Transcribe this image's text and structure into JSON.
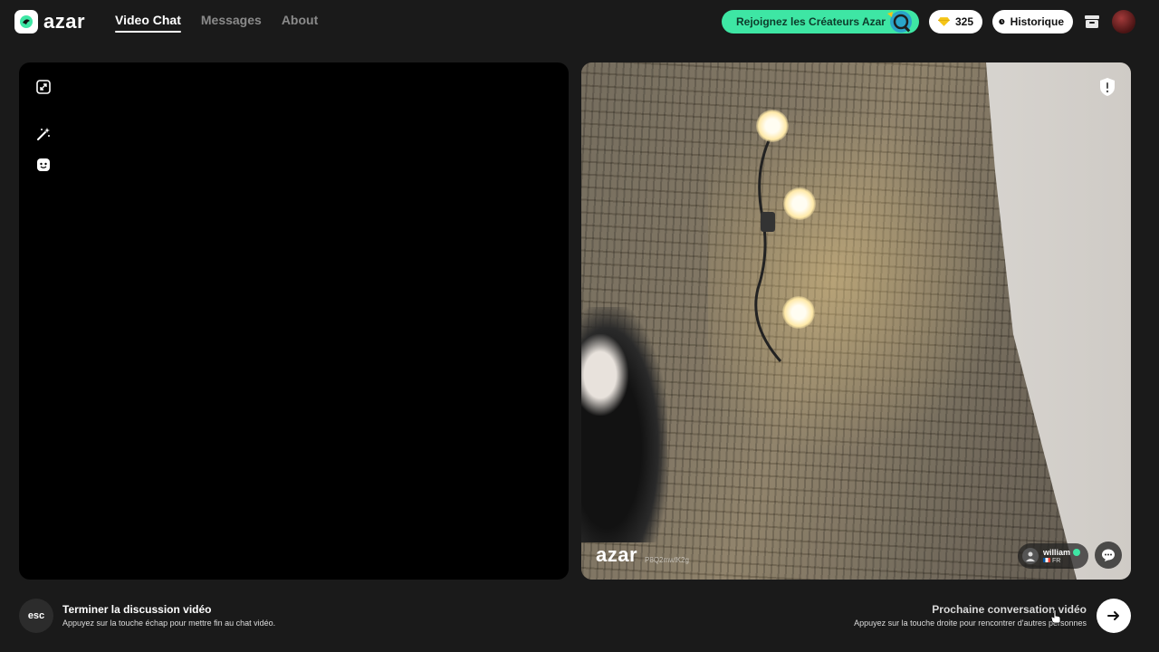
{
  "app": {
    "logo_text": "azar"
  },
  "nav": {
    "items": [
      {
        "label": "Video Chat",
        "active": true
      },
      {
        "label": "Messages",
        "active": false
      },
      {
        "label": "About",
        "active": false
      }
    ]
  },
  "header": {
    "creators_label": "Rejoignez les Créateurs Azar",
    "gems_count": "325",
    "history_label": "Historique"
  },
  "remote": {
    "watermark_logo": "azar",
    "watermark_code": "P8Q2mwlK2g",
    "user_name": "william",
    "user_country": "FR"
  },
  "footer": {
    "esc_key": "esc",
    "end_title": "Terminer la discussion vidéo",
    "end_sub": "Appuyez sur la touche échap pour mettre fin au chat vidéo.",
    "next_title": "Prochaine conversation vidéo",
    "next_sub": "Appuyez sur la touche droite pour rencontrer d'autres personnes"
  },
  "colors": {
    "accent_green": "#3ee6a4",
    "background": "#1a1a1a",
    "gem": "#f5c518"
  }
}
